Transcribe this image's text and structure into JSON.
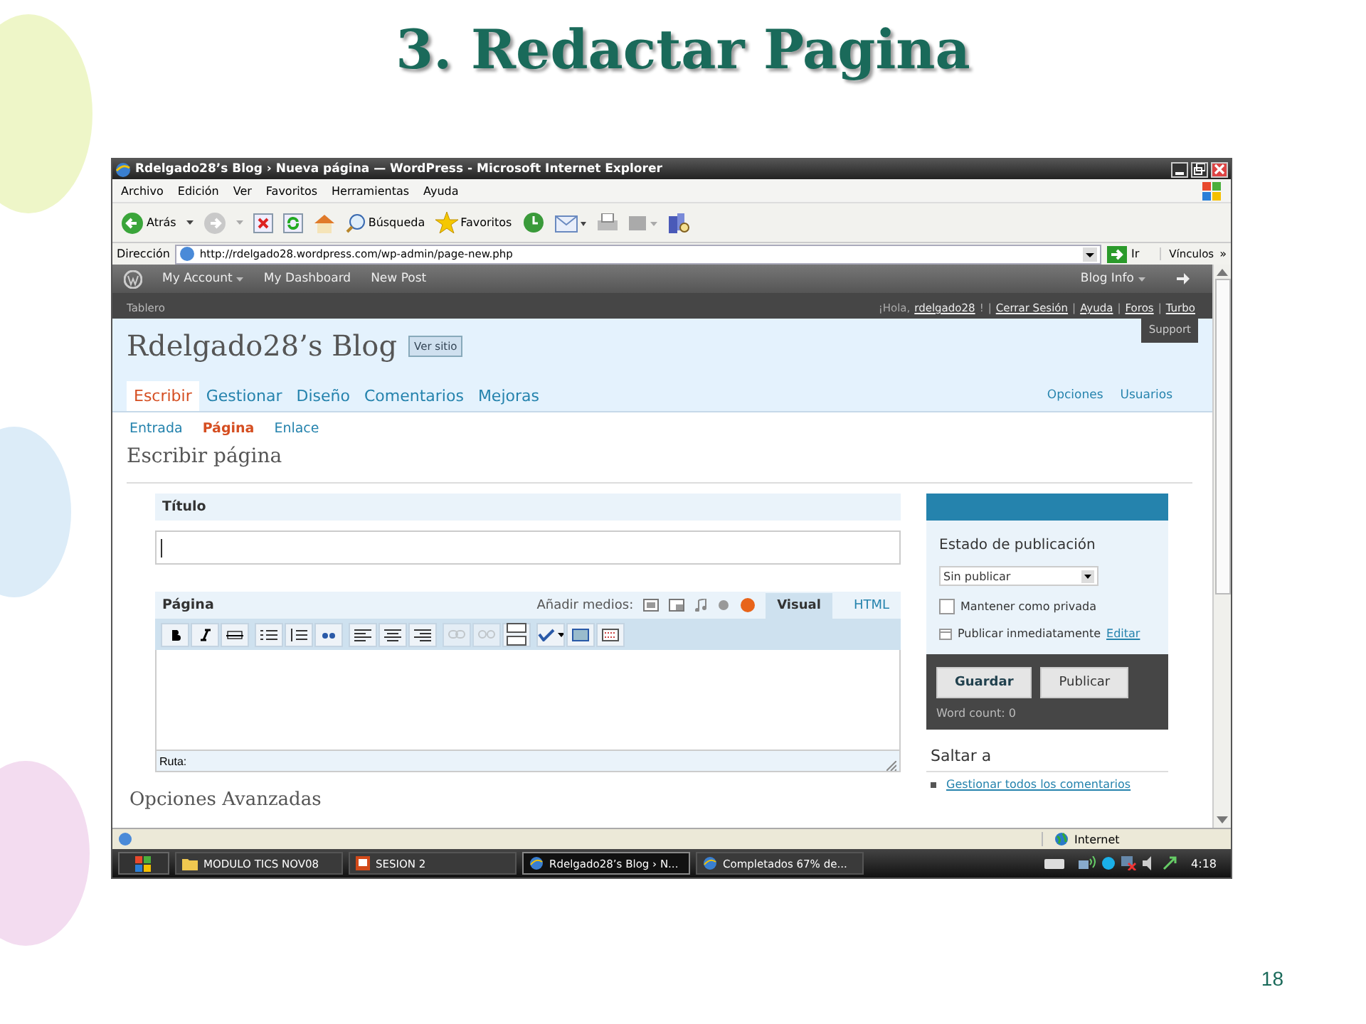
{
  "slide": {
    "title": "3. Redactar Pagina",
    "page_number": "18"
  },
  "browser": {
    "title": "Rdelgado28’s Blog › Nueva página — WordPress - Microsoft Internet Explorer",
    "menu": [
      "Archivo",
      "Edición",
      "Ver",
      "Favoritos",
      "Herramientas",
      "Ayuda"
    ],
    "back_label": "Atrás",
    "search_label": "Búsqueda",
    "favorites_label": "Favoritos",
    "address_label": "Dirección",
    "url": "http://rdelgado28.wordpress.com/wp-admin/page-new.php",
    "go_label": "Ir",
    "links_label": "Vínculos",
    "links_more": "»",
    "status_zone": "Internet"
  },
  "wp_bar": {
    "items": [
      {
        "label": "My Account",
        "menu": true
      },
      {
        "label": "My Dashboard",
        "menu": false
      },
      {
        "label": "New Post",
        "menu": false
      }
    ],
    "blog_info": "Blog Info"
  },
  "header": {
    "section": "Tablero",
    "greeting": "¡Hola,",
    "user": "rdelgado28",
    "user_suffix": "!",
    "separator": "|",
    "links": [
      "Cerrar Sesión",
      "Ayuda",
      "Foros",
      "Turbo"
    ],
    "support": "Support",
    "blog_title": "Rdelgado28’s Blog",
    "view_site": "Ver sitio"
  },
  "tabs": [
    {
      "label": "Escribir",
      "selected": true
    },
    {
      "label": "Gestionar",
      "selected": false
    },
    {
      "label": "Diseño",
      "selected": false
    },
    {
      "label": "Comentarios",
      "selected": false
    },
    {
      "label": "Mejoras",
      "selected": false
    }
  ],
  "right_tabs": [
    "Opciones",
    "Usuarios"
  ],
  "subtabs": [
    {
      "label": "Entrada",
      "selected": false
    },
    {
      "label": "Página",
      "selected": true
    },
    {
      "label": "Enlace",
      "selected": false
    }
  ],
  "heading": "Escribir página",
  "title_box": {
    "label": "Título"
  },
  "editor": {
    "label": "Página",
    "media_label": "Añadir medios:",
    "modes": [
      {
        "label": "Visual",
        "selected": true
      },
      {
        "label": "HTML",
        "selected": false
      }
    ],
    "path_label": "Ruta:"
  },
  "advanced": "Opciones Avanzadas",
  "publish": {
    "title": "Estado de publicación",
    "status": "Sin publicar",
    "private_label": "Mantener como privada",
    "private_checked": false,
    "schedule": "Publicar inmediatamente",
    "edit": "Editar",
    "save": "Guardar",
    "publish": "Publicar",
    "word_count": "Word count: 0"
  },
  "jump": {
    "title": "Saltar a",
    "links": [
      "Gestionar todos los comentarios"
    ]
  },
  "taskbar": {
    "items": [
      {
        "label": "MODULO TICS NOV08",
        "kind": "folder",
        "selected": false
      },
      {
        "label": "SESION 2",
        "kind": "slides",
        "selected": false
      },
      {
        "label": "Rdelgado28’s Blog › N...",
        "kind": "browser",
        "selected": true
      },
      {
        "label": "Completados 67% de...",
        "kind": "browser",
        "selected": false
      }
    ],
    "clock": "4:18"
  }
}
